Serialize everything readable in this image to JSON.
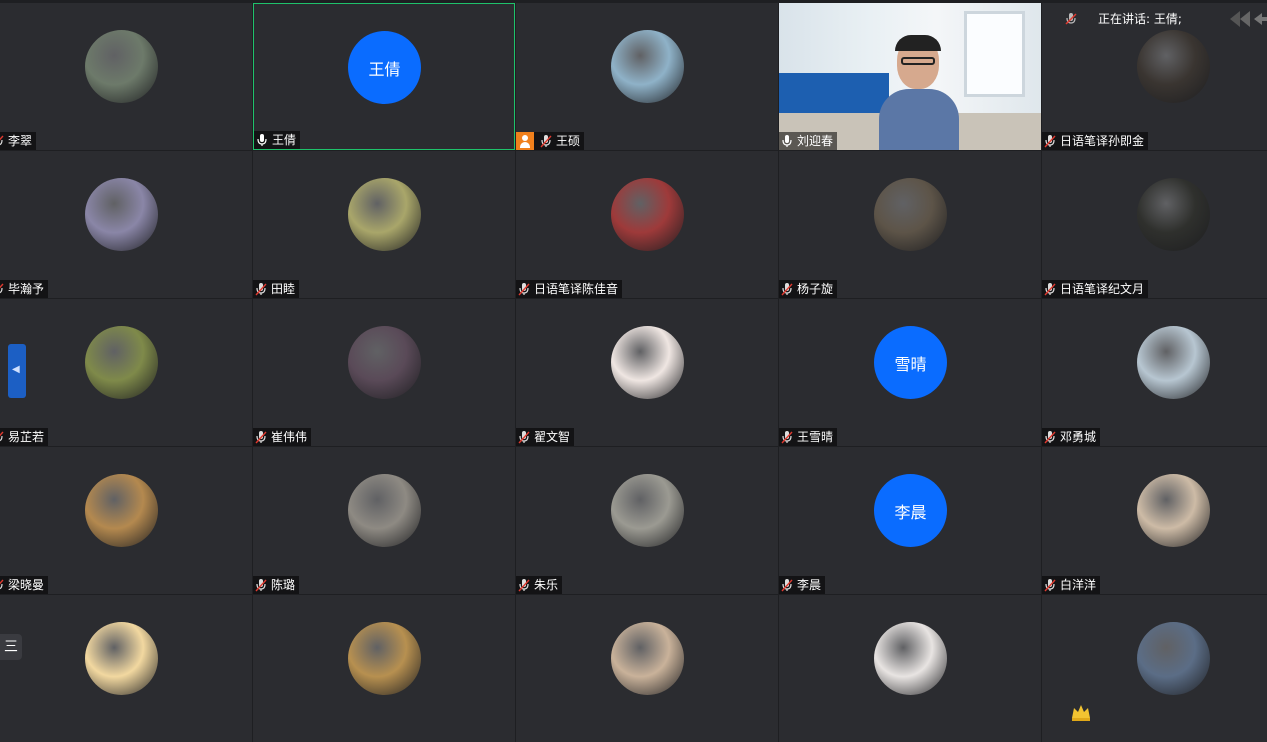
{
  "speaking": {
    "label": "正在讲话: 王倩;"
  },
  "menu_glyph": "三",
  "side_tab_glyph": "◀",
  "participants": [
    {
      "name": "李翠",
      "avatar": "photo",
      "color": "#6d7a6a"
    },
    {
      "name": "王倩",
      "avatar": "text",
      "text": "王倩",
      "active": true
    },
    {
      "name": "王硕",
      "avatar": "photo",
      "color": "#8fb2c8",
      "host": true
    },
    {
      "name": "刘迎春",
      "avatar": "video"
    },
    {
      "name": "日语笔译孙即金",
      "avatar": "photo",
      "color": "#3a3531"
    },
    {
      "name": "毕瀚予",
      "avatar": "photo",
      "color": "#8a86a7"
    },
    {
      "name": "田睦",
      "avatar": "photo",
      "color": "#a9a66a"
    },
    {
      "name": "日语笔译陈佳音",
      "avatar": "photo",
      "color": "#9e3a3a"
    },
    {
      "name": "杨子旋",
      "avatar": "photo",
      "color": "#5d5448"
    },
    {
      "name": "日语笔译纪文月",
      "avatar": "photo",
      "color": "#2f302d"
    },
    {
      "name": "易芷若",
      "avatar": "photo",
      "color": "#7f8a4a"
    },
    {
      "name": "崔伟伟",
      "avatar": "photo",
      "color": "#5a4a58"
    },
    {
      "name": "翟文智",
      "avatar": "photo",
      "color": "#efe6e2"
    },
    {
      "name": "王雪晴",
      "avatar": "text",
      "text": "雪晴"
    },
    {
      "name": "邓勇城",
      "avatar": "photo",
      "color": "#b7c6d1"
    },
    {
      "name": "梁晓曼",
      "avatar": "photo",
      "color": "#b4894f"
    },
    {
      "name": "陈璐",
      "avatar": "photo",
      "color": "#8e8a83"
    },
    {
      "name": "朱乐",
      "avatar": "photo",
      "color": "#9b9a92"
    },
    {
      "name": "李晨",
      "avatar": "text",
      "text": "李晨"
    },
    {
      "name": "白洋洋",
      "avatar": "photo",
      "color": "#cdbba6"
    },
    {
      "name": "",
      "avatar": "photo",
      "color": "#f2d8a0"
    },
    {
      "name": "",
      "avatar": "photo",
      "color": "#b79050"
    },
    {
      "name": "",
      "avatar": "photo",
      "color": "#c9b29a"
    },
    {
      "name": "",
      "avatar": "photo",
      "color": "#e8e4e2"
    },
    {
      "name": "",
      "avatar": "photo",
      "color": "#5b6d86"
    }
  ],
  "colors": {
    "background": "#1e1f22",
    "tile": "#2b2c30",
    "active_border": "#1fc26b",
    "text_avatar": "#0a6cff",
    "host_badge": "#f0801c"
  }
}
